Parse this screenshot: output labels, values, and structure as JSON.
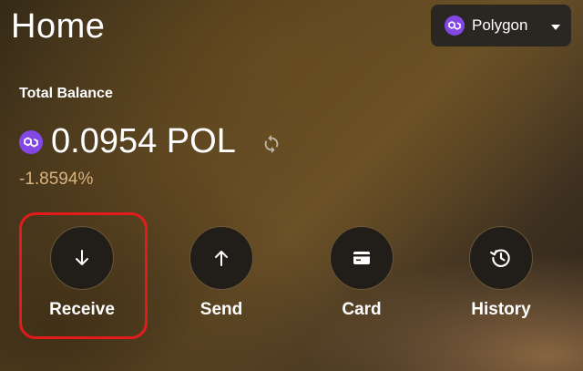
{
  "header": {
    "title": "Home",
    "network": {
      "label": "Polygon",
      "icon": "polygon-icon",
      "icon_color": "#8247e5"
    }
  },
  "balance": {
    "label": "Total Balance",
    "value": "0.0954 POL",
    "change": "-1.8594%",
    "change_color": "#d9b27e"
  },
  "actions": [
    {
      "label": "Receive",
      "icon": "arrow-down-icon",
      "highlighted": true
    },
    {
      "label": "Send",
      "icon": "arrow-up-icon",
      "highlighted": false
    },
    {
      "label": "Card",
      "icon": "card-icon",
      "highlighted": false
    },
    {
      "label": "History",
      "icon": "history-icon",
      "highlighted": false
    }
  ],
  "highlight_color": "#e31b1b"
}
